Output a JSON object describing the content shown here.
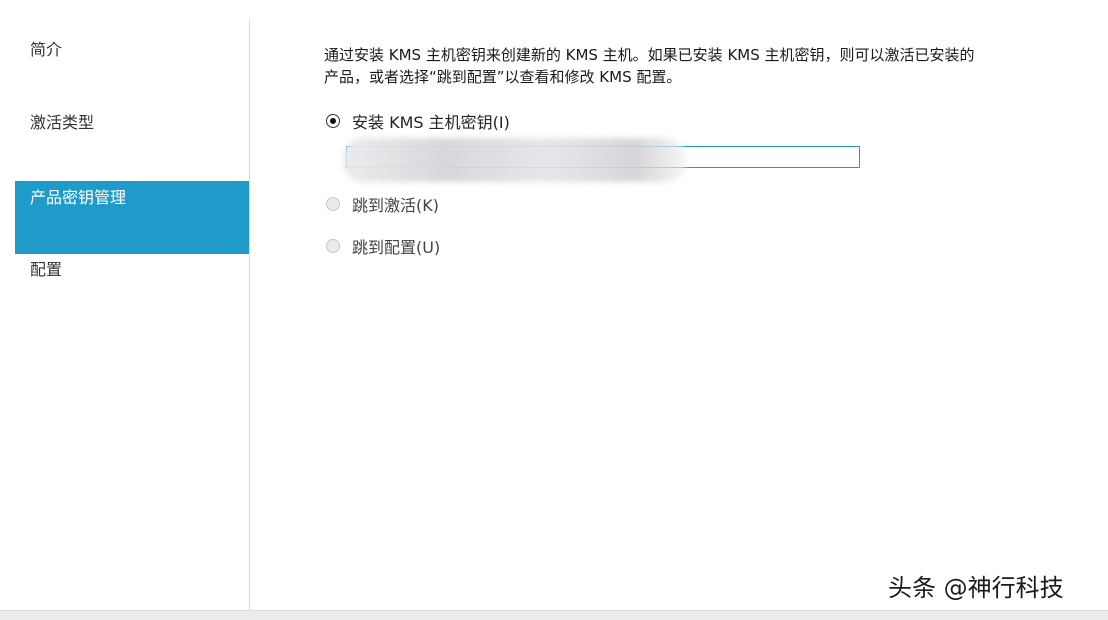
{
  "sidebar": {
    "items": [
      {
        "label": "简介"
      },
      {
        "label": "激活类型"
      },
      {
        "label": "产品密钥管理"
      },
      {
        "label": "配置"
      }
    ]
  },
  "main": {
    "description_line1": "通过安装 KMS 主机密钥来创建新的 KMS 主机。如果已安装 KMS 主机密钥，则可以激活已安装的",
    "description_line2": "产品，或者选择“跳到配置”以查看和修改 KMS 配置。",
    "options": [
      {
        "label": "安装 KMS 主机密钥(I)",
        "selected": true
      },
      {
        "label": "跳到激活(K)",
        "selected": false
      },
      {
        "label": "跳到配置(U)",
        "selected": false
      }
    ],
    "key_input": {
      "value": "",
      "redacted": true
    }
  },
  "watermark": "头条 @神行科技",
  "colors": {
    "accent": "#1e9bc9",
    "sidebar_active_text": "#ffffff",
    "border": "#d9d9d9"
  }
}
